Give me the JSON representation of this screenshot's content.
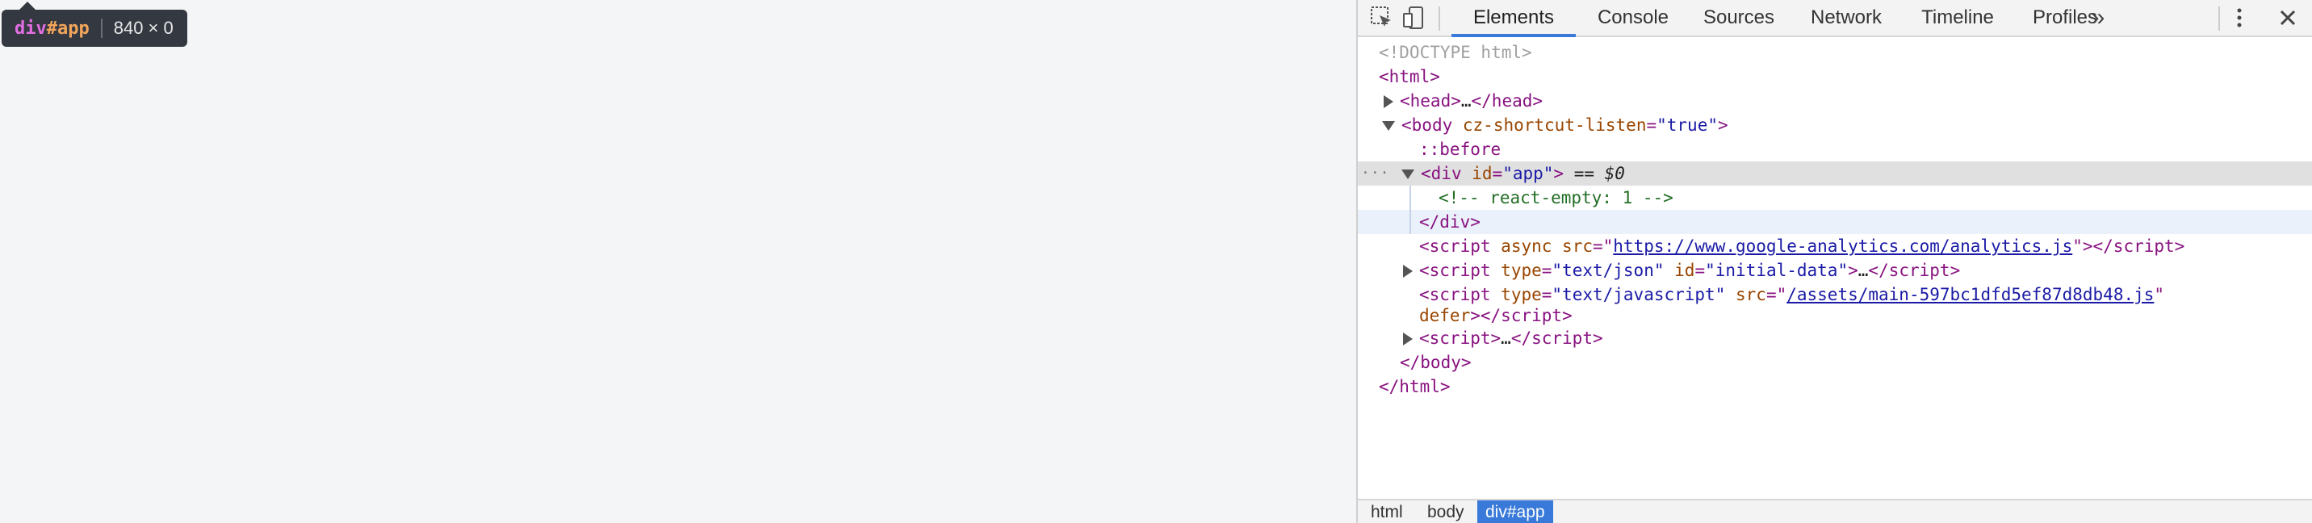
{
  "inspect_tooltip": {
    "tag": "div",
    "id": "#app",
    "dimensions": "840 × 0"
  },
  "devtools": {
    "toolbar": {
      "tabs": [
        {
          "label": "Elements",
          "active": true
        },
        {
          "label": "Console",
          "active": false
        },
        {
          "label": "Sources",
          "active": false
        },
        {
          "label": "Network",
          "active": false
        },
        {
          "label": "Timeline",
          "active": false
        },
        {
          "label": "Profiles",
          "active": false
        }
      ],
      "overflow_label": "»",
      "icons": [
        "inspect-element-icon",
        "device-mode-icon",
        "more-vert-icon",
        "close-icon"
      ]
    },
    "tree": {
      "doctype": "<!DOCTYPE html>",
      "html_open": "<html>",
      "head": {
        "open": "<head>",
        "ellipsis": "…",
        "close": "</head>"
      },
      "body_open": {
        "tag": "body",
        "attr": "cz-shortcut-listen",
        "value": "\"true\""
      },
      "before_pseudo": "::before",
      "div_app": {
        "tag": "div",
        "attr": "id",
        "value": "\"app\"",
        "selected_marker": "== $0"
      },
      "comment": "<!-- react-empty: 1 -->",
      "div_close": "</div>",
      "script_ga": {
        "attr1": "async",
        "attr2": "src",
        "url": "https://www.google-analytics.com/analytics.js"
      },
      "script_json": {
        "attr1": "type",
        "value1": "\"text/json\"",
        "attr2": "id",
        "value2": "\"initial-data\"",
        "ellipsis": "…"
      },
      "script_main": {
        "attr1": "type",
        "value1": "\"text/javascript\"",
        "attr2": "src",
        "url": "/assets/main-597bc1dfd5ef87d8db48.js",
        "attr3": "defer"
      },
      "script_inline": {
        "ellipsis": "…"
      },
      "body_close": "</body>",
      "html_close": "</html>"
    },
    "breadcrumbs": [
      {
        "label": "html",
        "active": false
      },
      {
        "label": "body",
        "active": false
      },
      {
        "label": "div#app",
        "active": true
      }
    ],
    "colors": {
      "accent": "#3879d9",
      "tag": "#881280",
      "attr_name": "#994500",
      "attr_value": "#1a1aa6",
      "comment": "#236e25"
    }
  }
}
